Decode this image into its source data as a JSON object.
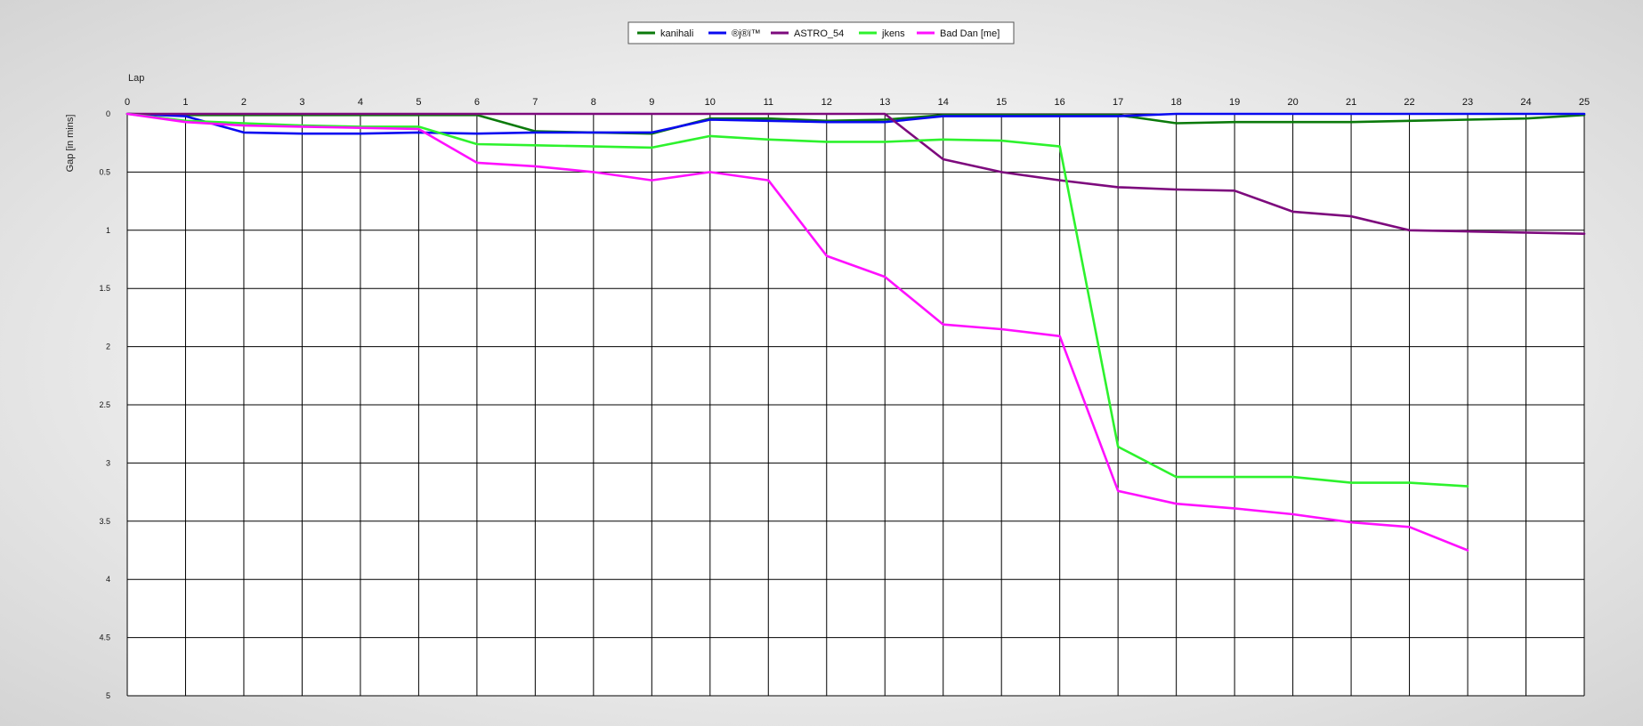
{
  "chart_data": {
    "type": "line",
    "xlabel": "Lap",
    "ylabel": "Gap [in mins]",
    "x": [
      0,
      1,
      2,
      3,
      4,
      5,
      6,
      7,
      8,
      9,
      10,
      11,
      12,
      13,
      14,
      15,
      16,
      17,
      18,
      19,
      20,
      21,
      22,
      23,
      24,
      25
    ],
    "x_ticks": [
      "0",
      "1",
      "2",
      "3",
      "4",
      "5",
      "6",
      "7",
      "8",
      "9",
      "10",
      "11",
      "12",
      "13",
      "14",
      "15",
      "16",
      "17",
      "18",
      "19",
      "20",
      "21",
      "22",
      "23",
      "24",
      "25"
    ],
    "y_ticks": [
      {
        "value": 0,
        "label": "0"
      },
      {
        "value": 0.5,
        "label": "0.5"
      },
      {
        "value": 1,
        "label": "1"
      },
      {
        "value": 1.5,
        "label": "1.5"
      },
      {
        "value": 2,
        "label": "2"
      },
      {
        "value": 2.5,
        "label": "2.5"
      },
      {
        "value": 3,
        "label": "3"
      },
      {
        "value": 3.5,
        "label": "3.5"
      },
      {
        "value": 4,
        "label": "4"
      },
      {
        "value": 4.5,
        "label": "4.5"
      },
      {
        "value": 5,
        "label": "5"
      }
    ],
    "xlim": [
      0,
      25
    ],
    "ylim": [
      0,
      5
    ],
    "y_inverted": true,
    "grid": true,
    "legend_position": "top-center",
    "series": [
      {
        "name": "kanihali",
        "color": "#0b7a0b",
        "values": [
          0,
          0.01,
          0.01,
          0.01,
          0.01,
          0.01,
          0.01,
          0.15,
          0.16,
          0.17,
          0.04,
          0.04,
          0.06,
          0.05,
          0.01,
          0.01,
          0.01,
          0.01,
          0.08,
          0.07,
          0.07,
          0.07,
          0.06,
          0.05,
          0.04,
          0.01
        ]
      },
      {
        "name": "®ј®ї™",
        "color": "#0a0af0",
        "values": [
          0,
          0.02,
          0.16,
          0.17,
          0.17,
          0.16,
          0.17,
          0.16,
          0.16,
          0.16,
          0.05,
          0.06,
          0.07,
          0.07,
          0.02,
          0.02,
          0.02,
          0.02,
          0.0,
          0.0,
          0.0,
          0.0,
          0.0,
          0.0,
          0.0,
          0.0
        ]
      },
      {
        "name": "ASTRO_54",
        "color": "#7d0a7d",
        "values": [
          0,
          0.0,
          0.0,
          0.0,
          0.0,
          0.0,
          0.0,
          0.0,
          0.0,
          0.0,
          0.0,
          0.0,
          0.0,
          0.0,
          0.39,
          0.5,
          0.57,
          0.63,
          0.65,
          0.66,
          0.84,
          0.88,
          1.0,
          1.01,
          1.02,
          1.03
        ]
      },
      {
        "name": "jkens",
        "color": "#2df22d",
        "values": [
          0,
          0.06,
          0.08,
          0.1,
          0.11,
          0.11,
          0.26,
          0.27,
          0.28,
          0.29,
          0.19,
          0.22,
          0.24,
          0.24,
          0.22,
          0.23,
          0.28,
          2.86,
          3.12,
          3.12,
          3.12,
          3.17,
          3.17,
          3.2,
          null,
          null
        ]
      },
      {
        "name": "Bad Dan [me]",
        "color": "#ff10ff",
        "values": [
          0,
          0.07,
          0.1,
          0.11,
          0.12,
          0.13,
          0.42,
          0.45,
          0.5,
          0.57,
          0.5,
          0.57,
          1.22,
          1.4,
          1.81,
          1.85,
          1.91,
          3.24,
          3.35,
          3.39,
          3.44,
          3.51,
          3.55,
          3.75,
          null,
          null
        ]
      }
    ]
  }
}
